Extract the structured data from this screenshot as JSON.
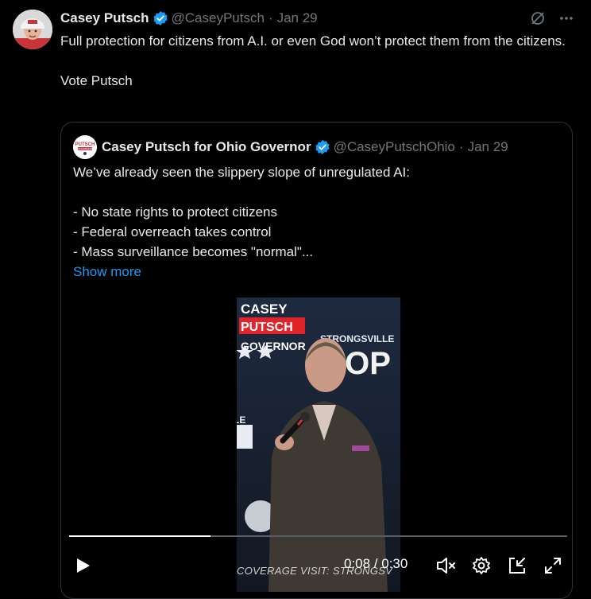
{
  "tweet": {
    "author_name": "Casey Putsch",
    "handle": "@CaseyPutsch",
    "separator": "·",
    "date": "Jan 29",
    "text_line1": "Full protection for citizens from A.I. or even God won’t protect them from the citizens.",
    "text_line2": "Vote Putsch",
    "icons": [
      "grok-icon",
      "more-icon",
      "verified-badge-icon"
    ]
  },
  "quote": {
    "author_name": "Casey Putsch for Ohio Governor",
    "avatar_text_top": "PUTSCH",
    "avatar_text_bottom": "GOVERNOR",
    "handle": "@CaseyPutschOhio",
    "separator": "·",
    "date": "Jan 29",
    "lines": [
      "We’ve already seen the slippery slope of unregulated AI:",
      "- No state rights to protect citizens",
      "- Federal overreach takes control",
      "- Mass surveillance becomes \"normal\"..."
    ],
    "show_more": "Show more"
  },
  "video": {
    "overlay_line1": "CASEY",
    "overlay_line2": "PUTSCH",
    "overlay_line3": "GOVERNOR",
    "backdrop_text1": "STRONGSVILLE",
    "backdrop_text2": "GOP",
    "backdrop_text3": "LE",
    "ticker": "COVERAGE VISIT: STRONGSV",
    "time": "0:08 / 0:30",
    "progress_fraction": 0.284,
    "icons": [
      "play-icon",
      "mute-icon",
      "settings-icon",
      "minimize-icon",
      "fullscreen-icon"
    ]
  }
}
